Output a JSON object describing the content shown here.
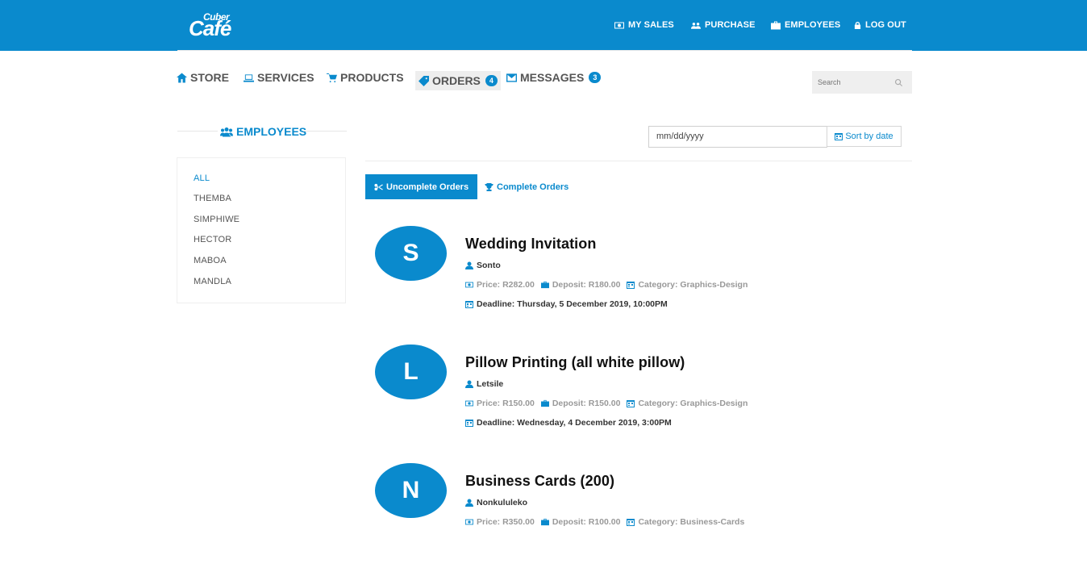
{
  "brand": {
    "small": "Cuber",
    "big": "Café"
  },
  "topnav": [
    {
      "label": "MY SALES",
      "icon": "money-icon"
    },
    {
      "label": "PURCHASE",
      "icon": "users-icon"
    },
    {
      "label": "EMPLOYEES",
      "icon": "briefcase-icon"
    },
    {
      "label": "LOG OUT",
      "icon": "lock-icon"
    }
  ],
  "mainnav": [
    {
      "label": "STORE",
      "icon": "home-icon"
    },
    {
      "label": "SERVICES",
      "icon": "laptop-icon"
    },
    {
      "label": "PRODUCTS",
      "icon": "cart-icon"
    },
    {
      "label": "ORDERS",
      "icon": "tag-icon",
      "badge": "4",
      "active": true
    },
    {
      "label": "MESSAGES",
      "icon": "envelope-icon",
      "badge": "3"
    }
  ],
  "search": {
    "placeholder": "Search"
  },
  "sidebar": {
    "title": "EMPLOYEES",
    "items": [
      "ALL",
      "THEMBA",
      "SIMPHIWE",
      "HECTOR",
      "MABOA",
      "MANDLA"
    ]
  },
  "filter": {
    "date_placeholder": "mm/dd/yyyy",
    "sort_label": "Sort by date"
  },
  "tabs": {
    "uncomplete": "Uncomplete Orders",
    "complete": "Complete Orders"
  },
  "orders": [
    {
      "initial": "S",
      "title": "Wedding Invitation",
      "customer": "Sonto",
      "price": "Price: R282.00",
      "deposit": "Deposit: R180.00",
      "category": "Category: Graphics-Design",
      "deadline": "Deadline: Thursday, 5 December 2019, 10:00PM"
    },
    {
      "initial": "L",
      "title": "Pillow Printing (all white pillow)",
      "customer": "Letsile",
      "price": "Price: R150.00",
      "deposit": "Deposit: R150.00",
      "category": "Category: Graphics-Design",
      "deadline": "Deadline: Wednesday, 4 December 2019, 3:00PM"
    },
    {
      "initial": "N",
      "title": "Business Cards (200)",
      "customer": "Nonkululeko",
      "price": "Price: R350.00",
      "deposit": "Deposit: R100.00",
      "category": "Category: Business-Cards",
      "deadline": ""
    }
  ],
  "colors": {
    "primary": "#0a8acd",
    "text": "#333333",
    "muted": "#999999"
  }
}
